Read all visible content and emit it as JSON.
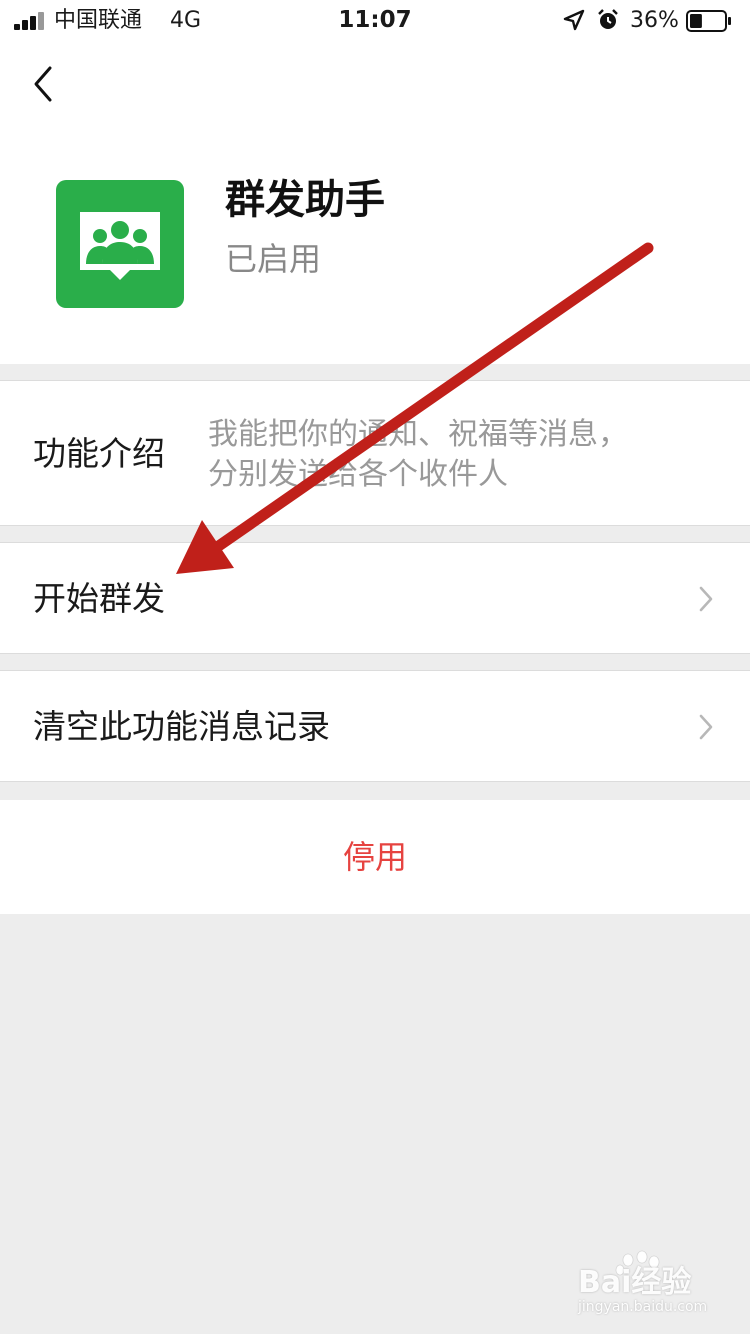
{
  "status_bar": {
    "carrier": "中国联通",
    "network": "4G",
    "time": "11:07",
    "battery_percent": "36%",
    "battery_level": 0.36,
    "icons": [
      "signal-icon",
      "location-icon",
      "alarm-icon",
      "battery-icon"
    ]
  },
  "header": {
    "back_icon": "chevron-left-icon"
  },
  "app": {
    "name": "群发助手",
    "status": "已启用",
    "icon": "group-message-icon",
    "icon_color": "#2aae4a"
  },
  "menu": {
    "intro_label": "功能介绍",
    "intro_desc_line1": "我能把你的通知、祝福等消息，",
    "intro_desc_line2": "分别发送给各个收件人",
    "start_label": "开始群发",
    "clear_label": "清空此功能消息记录"
  },
  "actions": {
    "disable_label": "停用",
    "disable_color": "#e64340"
  },
  "annotation": {
    "arrow_color": "#c0201a"
  },
  "watermark": {
    "text": "Bai经验",
    "sub": "jingyan.baidu.com"
  }
}
